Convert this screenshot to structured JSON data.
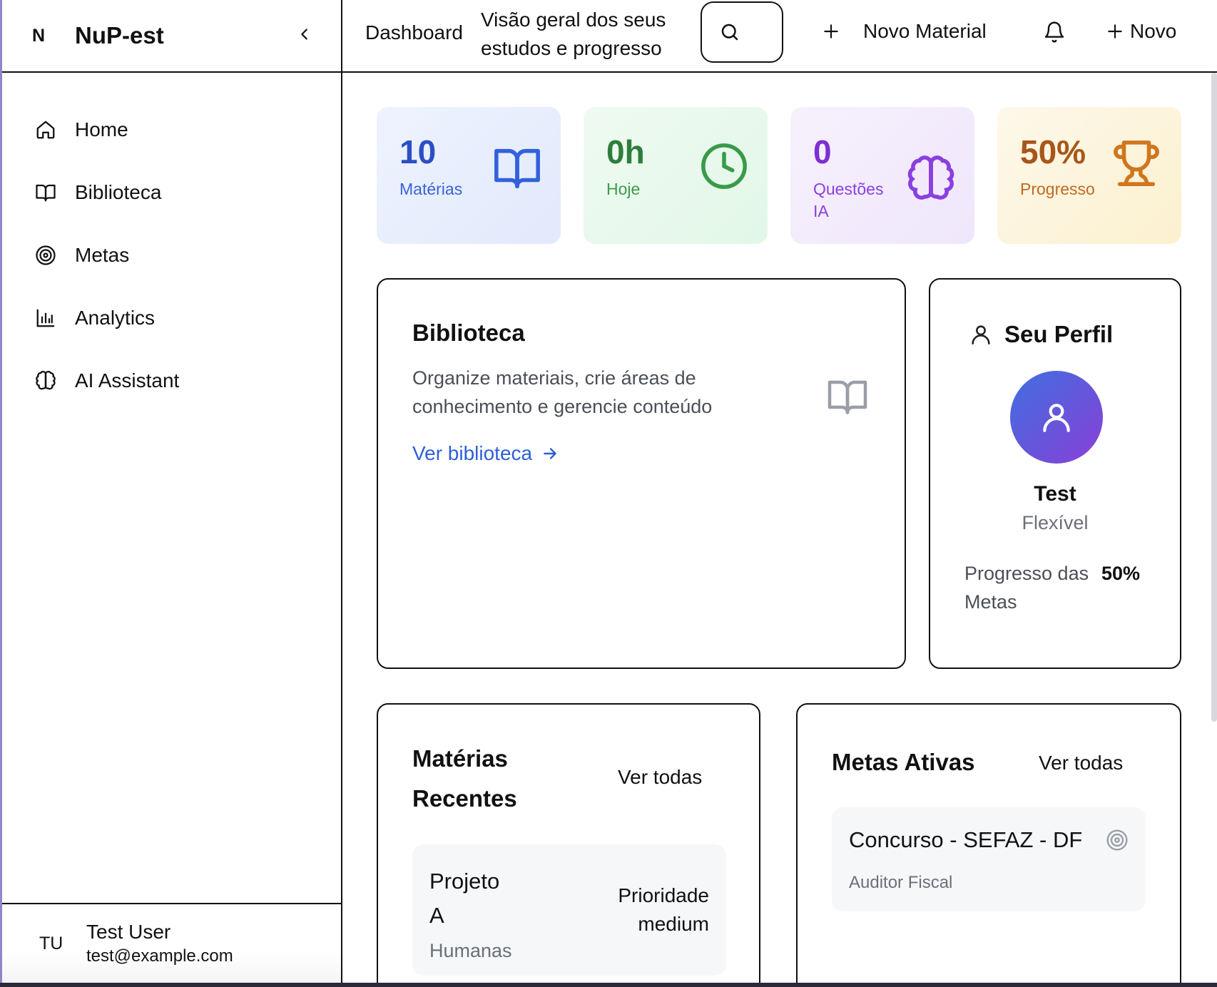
{
  "sidebar": {
    "logo": "N",
    "app_title": "NuP-est",
    "items": [
      {
        "label": "Home",
        "icon": "home-icon"
      },
      {
        "label": "Biblioteca",
        "icon": "book-icon"
      },
      {
        "label": "Metas",
        "icon": "target-icon"
      },
      {
        "label": "Analytics",
        "icon": "bar-chart-icon"
      },
      {
        "label": "AI Assistant",
        "icon": "brain-icon"
      }
    ],
    "user": {
      "initials": "TU",
      "name": "Test User",
      "email": "test@example.com"
    }
  },
  "header": {
    "title": "Dashboard",
    "subtitle": "Visão geral dos seus estudos e progresso",
    "new_material": "Novo Material",
    "new": "Novo"
  },
  "stats": [
    {
      "value": "10",
      "label": "Matérias",
      "color": "#2d4fc4",
      "icon": "book-open-icon"
    },
    {
      "value": "0h",
      "label": "Hoje",
      "color": "#2f7d3c",
      "icon": "clock-icon"
    },
    {
      "value": "0",
      "label": "Questões IA",
      "color": "#7c2fd2",
      "icon": "brain-icon"
    },
    {
      "value": "50%",
      "label": "Progresso",
      "color": "#a8561a",
      "icon": "trophy-icon"
    }
  ],
  "library_card": {
    "title": "Biblioteca",
    "description": "Organize materiais, crie áreas de conhecimento e gerencie conteúdo",
    "link": "Ver biblioteca"
  },
  "profile_card": {
    "title": "Seu Perfil",
    "name": "Test",
    "type": "Flexível",
    "progress_label": "Progresso das Metas",
    "progress_value": "50%"
  },
  "recent_subjects": {
    "title": "Matérias Recentes",
    "view_all": "Ver todas",
    "items": [
      {
        "name": "Projeto A",
        "area": "Humanas",
        "priority": "Prioridade medium"
      }
    ]
  },
  "active_goals": {
    "title": "Metas Ativas",
    "view_all": "Ver todas",
    "items": [
      {
        "name": "Concurso - SEFAZ - DF",
        "role": "Auditor Fiscal"
      }
    ]
  }
}
